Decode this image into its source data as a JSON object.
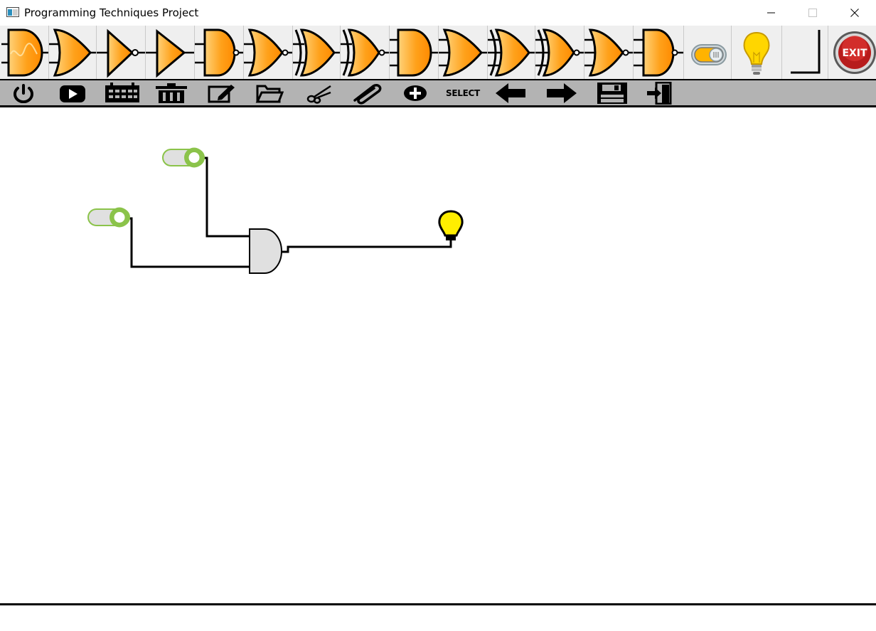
{
  "window": {
    "title": "Programming Techniques Project",
    "icons": [
      "app-icon",
      "minimize-icon",
      "maximize-icon",
      "close-icon"
    ]
  },
  "gate_toolbar": {
    "items": [
      {
        "name": "and2-gate-icon",
        "kind": "and"
      },
      {
        "name": "or2-gate-icon",
        "kind": "or"
      },
      {
        "name": "not-gate-icon",
        "kind": "not"
      },
      {
        "name": "buffer-gate-icon",
        "kind": "buffer"
      },
      {
        "name": "nand2-gate-icon",
        "kind": "nand"
      },
      {
        "name": "nor2-gate-icon",
        "kind": "nor"
      },
      {
        "name": "xor2-gate-icon",
        "kind": "xor"
      },
      {
        "name": "xnor2-gate-icon",
        "kind": "xnor"
      },
      {
        "name": "and3-gate-icon",
        "kind": "and3"
      },
      {
        "name": "or3-gate-icon",
        "kind": "or3"
      },
      {
        "name": "xor3-gate-icon",
        "kind": "xor3"
      },
      {
        "name": "xnor3-gate-icon",
        "kind": "xnor3"
      },
      {
        "name": "nor3-gate-icon",
        "kind": "nor3"
      },
      {
        "name": "nand3-gate-icon",
        "kind": "nand3"
      },
      {
        "name": "switch-icon",
        "kind": "switch"
      },
      {
        "name": "led-bulb-icon",
        "kind": "bulb"
      },
      {
        "name": "wire-icon",
        "kind": "wire"
      },
      {
        "name": "exit-icon",
        "kind": "exit",
        "label": "EXIT"
      }
    ]
  },
  "action_toolbar": {
    "items": [
      {
        "name": "power-icon"
      },
      {
        "name": "simulate-play-icon"
      },
      {
        "name": "truth-table-icon"
      },
      {
        "name": "delete-trash-icon"
      },
      {
        "name": "edit-label-icon"
      },
      {
        "name": "load-folder-icon"
      },
      {
        "name": "cut-scissors-icon"
      },
      {
        "name": "copy-paperclip-icon"
      },
      {
        "name": "add-plus-icon"
      },
      {
        "name": "select-button",
        "label": "SELECT"
      },
      {
        "name": "undo-arrow-icon"
      },
      {
        "name": "redo-arrow-icon"
      },
      {
        "name": "save-floppy-icon"
      },
      {
        "name": "exit-door-icon"
      }
    ]
  },
  "circuit": {
    "components": [
      {
        "type": "switch",
        "id": "switch-1",
        "state": "off"
      },
      {
        "type": "switch",
        "id": "switch-2",
        "state": "off"
      },
      {
        "type": "and-gate",
        "id": "gate-1",
        "inputs": 2
      },
      {
        "type": "bulb",
        "id": "led-1",
        "state": "on"
      }
    ],
    "connections": [
      {
        "from": "switch-1",
        "to": "gate-1"
      },
      {
        "from": "switch-2",
        "to": "gate-1"
      },
      {
        "from": "gate-1",
        "to": "led-1"
      }
    ],
    "colors": {
      "switch": "#8bc34a",
      "bulb": "#ffee00",
      "gate_fill": "#e0e0e0",
      "gate_icon": "#ff9900"
    }
  }
}
